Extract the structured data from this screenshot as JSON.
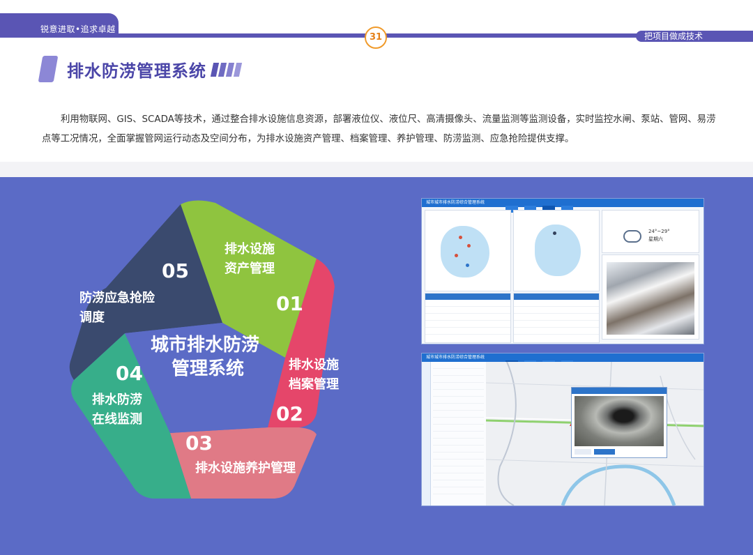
{
  "header": {
    "left_slogan": "锐意进取•追求卓越",
    "right_slogan": "把项目做成技术",
    "page_number": "31"
  },
  "section": {
    "title": "排水防涝管理系统",
    "description": "利用物联网、GIS、SCADA等技术，通过整合排水设施信息资源，部署液位仪、液位尺、高清摄像头、流量监测等监测设备，实时监控水闸、泵站、管网、易涝点等工况情况，全面掌握管网运行动态及空间分布，为排水设施资产管理、档案管理、养护管理、防涝监测、应急抢险提供支撑。"
  },
  "diagram": {
    "center": [
      "城市排水防涝",
      "管理系统"
    ],
    "segments": [
      {
        "num": "01",
        "label": [
          "排水设施",
          "资产管理"
        ],
        "color": "#8fc43f"
      },
      {
        "num": "02",
        "label": [
          "排水设施",
          "档案管理"
        ],
        "color": "#e5466a"
      },
      {
        "num": "03",
        "label": [
          "排水设施养护管理"
        ],
        "color": "#e07a86"
      },
      {
        "num": "04",
        "label": [
          "排水防涝",
          "在线监测"
        ],
        "color": "#37ae8a"
      },
      {
        "num": "05",
        "label": [
          "防涝应急抢险",
          "调度"
        ],
        "color": "#3a4a6e"
      }
    ]
  },
  "screenshots": {
    "dashboard_title": "城市城市排水防涝综合管理系统",
    "map_title": "城市城市排水防涝综合管理系统",
    "weather": {
      "temp": "24°~29°",
      "day": "星期六"
    }
  },
  "colors": {
    "brand": "#5a55b4",
    "panel": "#5b6bc6",
    "accent": "#f09a2a"
  }
}
